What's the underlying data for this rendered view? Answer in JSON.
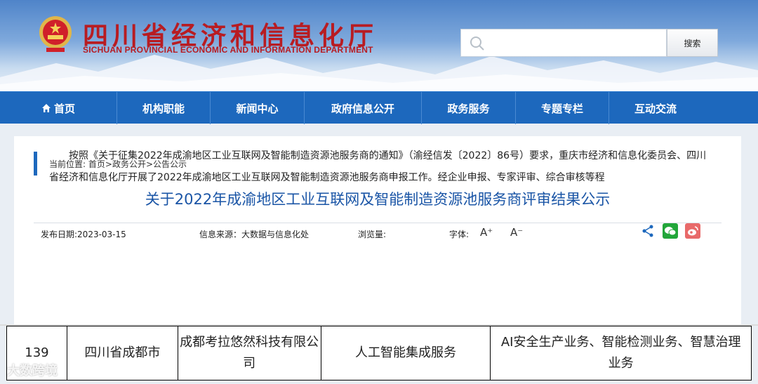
{
  "header": {
    "title_cn": "四川省经济和信息化厅",
    "title_en": "SICHUAN PROVINCIAL ECONOMIC AND INFORMATION DEPARTMENT",
    "search_placeholder": "",
    "search_button": "搜索"
  },
  "nav": {
    "items": [
      {
        "label": "首页",
        "icon": "home-icon"
      },
      {
        "label": "机构职能"
      },
      {
        "label": "新闻中心"
      },
      {
        "label": "政府信息公开"
      },
      {
        "label": "政务服务"
      },
      {
        "label": "专题专栏"
      },
      {
        "label": "互动交流"
      }
    ]
  },
  "breadcrumb": {
    "prefix": "当前位置:",
    "items": [
      "首页",
      "政务公开",
      "公告公示"
    ],
    "separator": ">"
  },
  "article": {
    "title": "关于2022年成渝地区工业互联网及智能制造资源池服务商评审结果公示",
    "publish_date": "发布日期:2023-03-15",
    "source": "信息来源：大数据与信息化处",
    "views": "浏览量:",
    "font_label": "字体:",
    "font_increase": "A⁺",
    "font_decrease": "A⁻",
    "paragraph": "按照《关于征集2022年成渝地区工业互联网及智能制造资源池服务商的通知》（渝经信发〔2022〕86号）要求，重庆市经济和信息化委员会、四川省经济和信息化厅开展了2022年成渝地区工业互联网及智能制造资源池服务商申报工作。经企业申报、专家评审、综合审核等程"
  },
  "table": {
    "row": {
      "index": "139",
      "region": "四川省成都市",
      "company": "成都考拉悠然科技有限公司",
      "service": "人工智能集成服务",
      "business": "AI安全生产业务、智能检测业务、智慧治理业务"
    }
  },
  "watermark": "大数跨境",
  "colors": {
    "nav_bg": "#1d68bd",
    "title_red": "#b81c22",
    "article_title": "#1a55a6"
  }
}
